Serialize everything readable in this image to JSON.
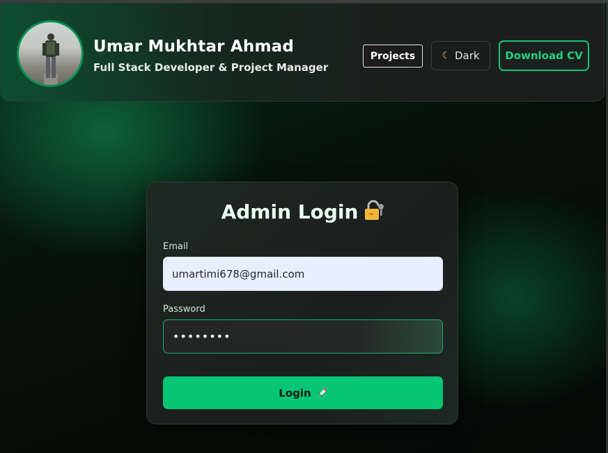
{
  "header": {
    "name": "Umar Mukhtar Ahmad",
    "role": "Full Stack Developer & Project Manager",
    "projects_label": "Projects",
    "theme_label": "Dark",
    "theme_icon": "moon-icon",
    "download_label": "Download CV"
  },
  "login": {
    "title": "Admin Login",
    "title_icon": "lock-icon",
    "email_label": "Email",
    "email_value": "umartimi678@gmail.com",
    "password_label": "Password",
    "password_value": "••••••••",
    "button_label": "Login",
    "button_icon": "rocket-icon"
  },
  "colors": {
    "accent": "#06c574",
    "download_border": "#18c27a",
    "email_bg": "#e8effd"
  }
}
